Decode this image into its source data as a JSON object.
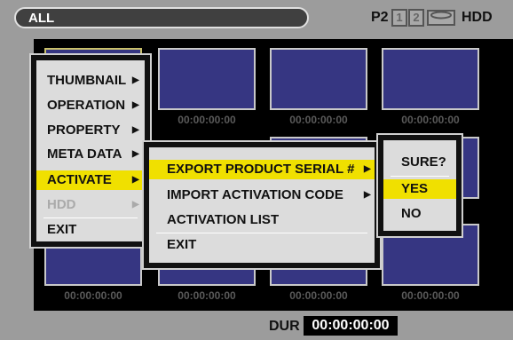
{
  "header": {
    "mode": "ALL",
    "media_label": "P2",
    "slot1": "1",
    "slot2": "2",
    "drive_label": "HDD"
  },
  "thumbnails": [
    {
      "timecode": ""
    },
    {
      "timecode": "00:00:00:00"
    },
    {
      "timecode": "00:00:00:00"
    },
    {
      "timecode": "00:00:00:00"
    },
    {
      "timecode": "00:00:00:00"
    },
    {
      "timecode": "00:00:00:00"
    },
    {
      "timecode": "00:00:00:00"
    },
    {
      "timecode": "00:00:00:00"
    }
  ],
  "main_menu": {
    "items": [
      {
        "label": "THUMBNAIL",
        "arrow": "▶"
      },
      {
        "label": "OPERATION",
        "arrow": "▶"
      },
      {
        "label": "PROPERTY",
        "arrow": "▶"
      },
      {
        "label": "META DATA",
        "arrow": "▶"
      },
      {
        "label": "ACTIVATE",
        "arrow": "▶"
      },
      {
        "label": "HDD",
        "arrow": "▶"
      },
      {
        "label": "EXIT",
        "arrow": ""
      }
    ]
  },
  "activate_menu": {
    "items": [
      {
        "label": "EXPORT PRODUCT SERIAL #",
        "arrow": "▶"
      },
      {
        "label": "IMPORT ACTIVATION CODE",
        "arrow": "▶"
      },
      {
        "label": "ACTIVATION LIST",
        "arrow": ""
      },
      {
        "label": "EXIT",
        "arrow": ""
      }
    ]
  },
  "confirm_menu": {
    "prompt": "SURE?",
    "yes": "YES",
    "no": "NO"
  },
  "footer": {
    "dur_label": "DUR",
    "dur_value": "00:00:00:00"
  },
  "colors": {
    "highlight": "#f0e000",
    "thumbnail": "#363682",
    "background": "#9c9c9c"
  }
}
